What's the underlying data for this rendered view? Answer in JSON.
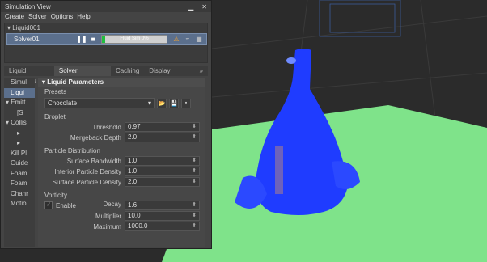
{
  "window": {
    "title": "Simulation View",
    "minimize_icon": "minimize-icon",
    "close_icon": "close-icon"
  },
  "menu": [
    "Create",
    "Solver",
    "Options",
    "Help"
  ],
  "tree": {
    "liquid": "Liquid001",
    "solver": "Solver01",
    "progress_text": "Fluid Sim 0%",
    "progress_value": 0.05
  },
  "tabs": [
    "Liquid Attributes",
    "Solver Parameters",
    "Caching",
    "Display Settings"
  ],
  "tabs_more": "»",
  "sidebar": [
    "Simul",
    "Liqui",
    "Emitt",
    "[S",
    "Collis",
    "",
    "",
    "Kill Pl",
    "Guide",
    "Foam",
    "Foam",
    "Chanr",
    "Motio"
  ],
  "params": {
    "header": "Liquid Parameters",
    "presets_label": "Presets",
    "preset_value": "Chocolate",
    "droplet": "Droplet",
    "threshold_label": "Threshold",
    "threshold": "0.97",
    "mergeback_label": "Mergeback Depth",
    "mergeback": "2.0",
    "pd": "Particle Distribution",
    "surface_bw_label": "Surface Bandwidth",
    "surface_bw": "1.0",
    "interior_label": "Interior Particle Density",
    "interior": "1.0",
    "surface_pd_label": "Surface Particle Density",
    "surface_pd": "2.0",
    "vorticity": "Vorticity",
    "enable_label": "Enable",
    "decay_label": "Decay",
    "decay": "1.6",
    "multiplier_label": "Multiplier",
    "multiplier": "10.0",
    "maximum_label": "Maximum",
    "maximum": "1000.0"
  },
  "colors": {
    "liquid": "#1f3cff",
    "ground": "#7fe38a",
    "accent": "#5b6f8c"
  }
}
